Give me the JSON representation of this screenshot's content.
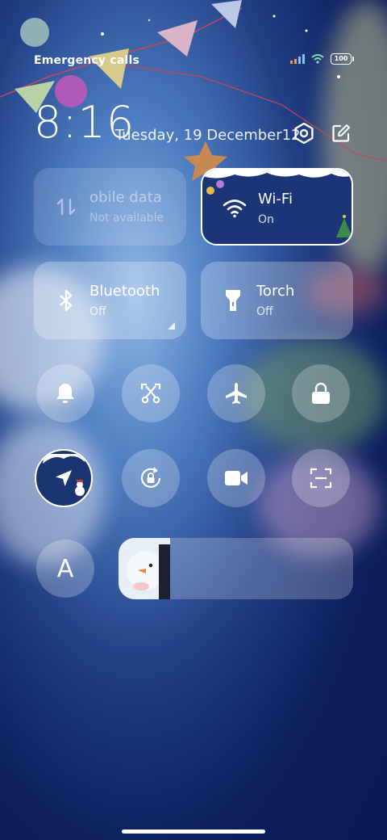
{
  "status_bar": {
    "carrier_text": "Emergency calls",
    "battery_level": "100"
  },
  "header": {
    "time": "8:16",
    "date": "Tuesday, 19 December12"
  },
  "tiles": {
    "mobile_data": {
      "title": "obile data",
      "status": "Not available"
    },
    "wifi": {
      "title": "Wi-Fi",
      "status": "On"
    },
    "bluetooth": {
      "title": "Bluetooth",
      "status": "Off"
    },
    "torch": {
      "title": "Torch",
      "status": "Off"
    }
  },
  "toggles": [
    {
      "icon": "bell-icon",
      "active": false
    },
    {
      "icon": "screenshot-scissors-icon",
      "active": false
    },
    {
      "icon": "airplane-icon",
      "active": false
    },
    {
      "icon": "lock-icon",
      "active": false
    },
    {
      "icon": "location-icon",
      "active": true
    },
    {
      "icon": "rotation-lock-icon",
      "active": false
    },
    {
      "icon": "video-camera-icon",
      "active": false
    },
    {
      "icon": "scan-icon",
      "active": false
    }
  ],
  "auto_brightness_letter": "A",
  "brightness": {
    "level": 0.22
  },
  "colors": {
    "accent_active": "#1b3472"
  }
}
